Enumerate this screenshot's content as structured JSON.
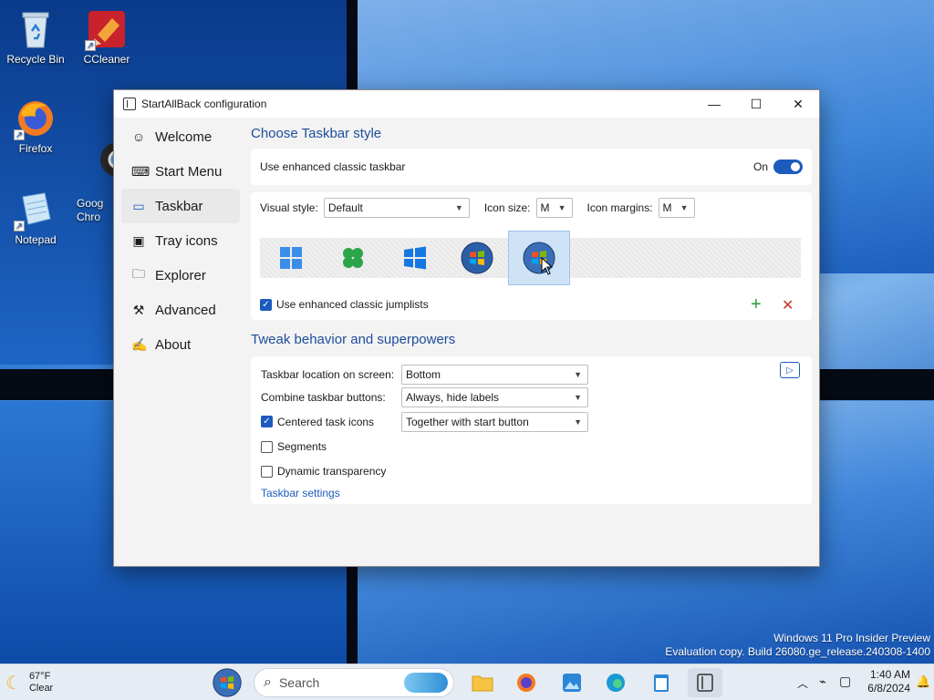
{
  "desktop": {
    "icons": [
      {
        "label": "Recycle Bin"
      },
      {
        "label": "CCleaner"
      },
      {
        "label": "Firefox"
      },
      {
        "label": "Goog\nChro"
      },
      {
        "label": "Notepad"
      }
    ],
    "watermark": {
      "line1": "Windows 11 Pro Insider Preview",
      "line2": "Evaluation copy. Build 26080.ge_release.240308-1400"
    }
  },
  "window": {
    "title": "StartAllBack configuration",
    "controls": {
      "minimize": "—",
      "maximize": "☐",
      "close": "✕"
    }
  },
  "sidebar": {
    "items": [
      {
        "label": "Welcome",
        "icon": "smile-icon"
      },
      {
        "label": "Start Menu",
        "icon": "keyboard-icon"
      },
      {
        "label": "Taskbar",
        "icon": "taskbar-icon",
        "active": true
      },
      {
        "label": "Tray icons",
        "icon": "tray-icon"
      },
      {
        "label": "Explorer",
        "icon": "folder-icon"
      },
      {
        "label": "Advanced",
        "icon": "wrench-icon"
      },
      {
        "label": "About",
        "icon": "signature-icon"
      }
    ]
  },
  "taskbar_style": {
    "section_title": "Choose Taskbar style",
    "enhanced_label": "Use enhanced classic taskbar",
    "toggle_state": "On",
    "visual_style_label": "Visual style:",
    "visual_style_value": "Default",
    "icon_size_label": "Icon size:",
    "icon_size_value": "M",
    "icon_margins_label": "Icon margins:",
    "icon_margins_value": "M",
    "styles": [
      "windows-11-icon",
      "clover-icon",
      "windows-10-icon",
      "windows-7-orb-icon",
      "windows-vista-orb-icon"
    ],
    "selected_style": 4,
    "jumplists_label": "Use enhanced classic jumplists",
    "jumplists_checked": true
  },
  "behavior": {
    "section_title": "Tweak behavior and superpowers",
    "location_label": "Taskbar location on screen:",
    "location_value": "Bottom",
    "combine_label": "Combine taskbar buttons:",
    "combine_value": "Always, hide labels",
    "centered_label": "Centered task icons",
    "centered_checked": true,
    "centered_value": "Together with start button",
    "segments_label": "Segments",
    "segments_checked": false,
    "dynamic_label": "Dynamic transparency",
    "dynamic_checked": false,
    "settings_link": "Taskbar settings"
  },
  "taskbar": {
    "weather_temp": "67°F",
    "weather_desc": "Clear",
    "search_placeholder": "Search",
    "time": "1:40 AM",
    "date": "6/8/2024"
  },
  "colors": {
    "accent": "#1d5bbf",
    "section_title": "#1d4d9a"
  }
}
